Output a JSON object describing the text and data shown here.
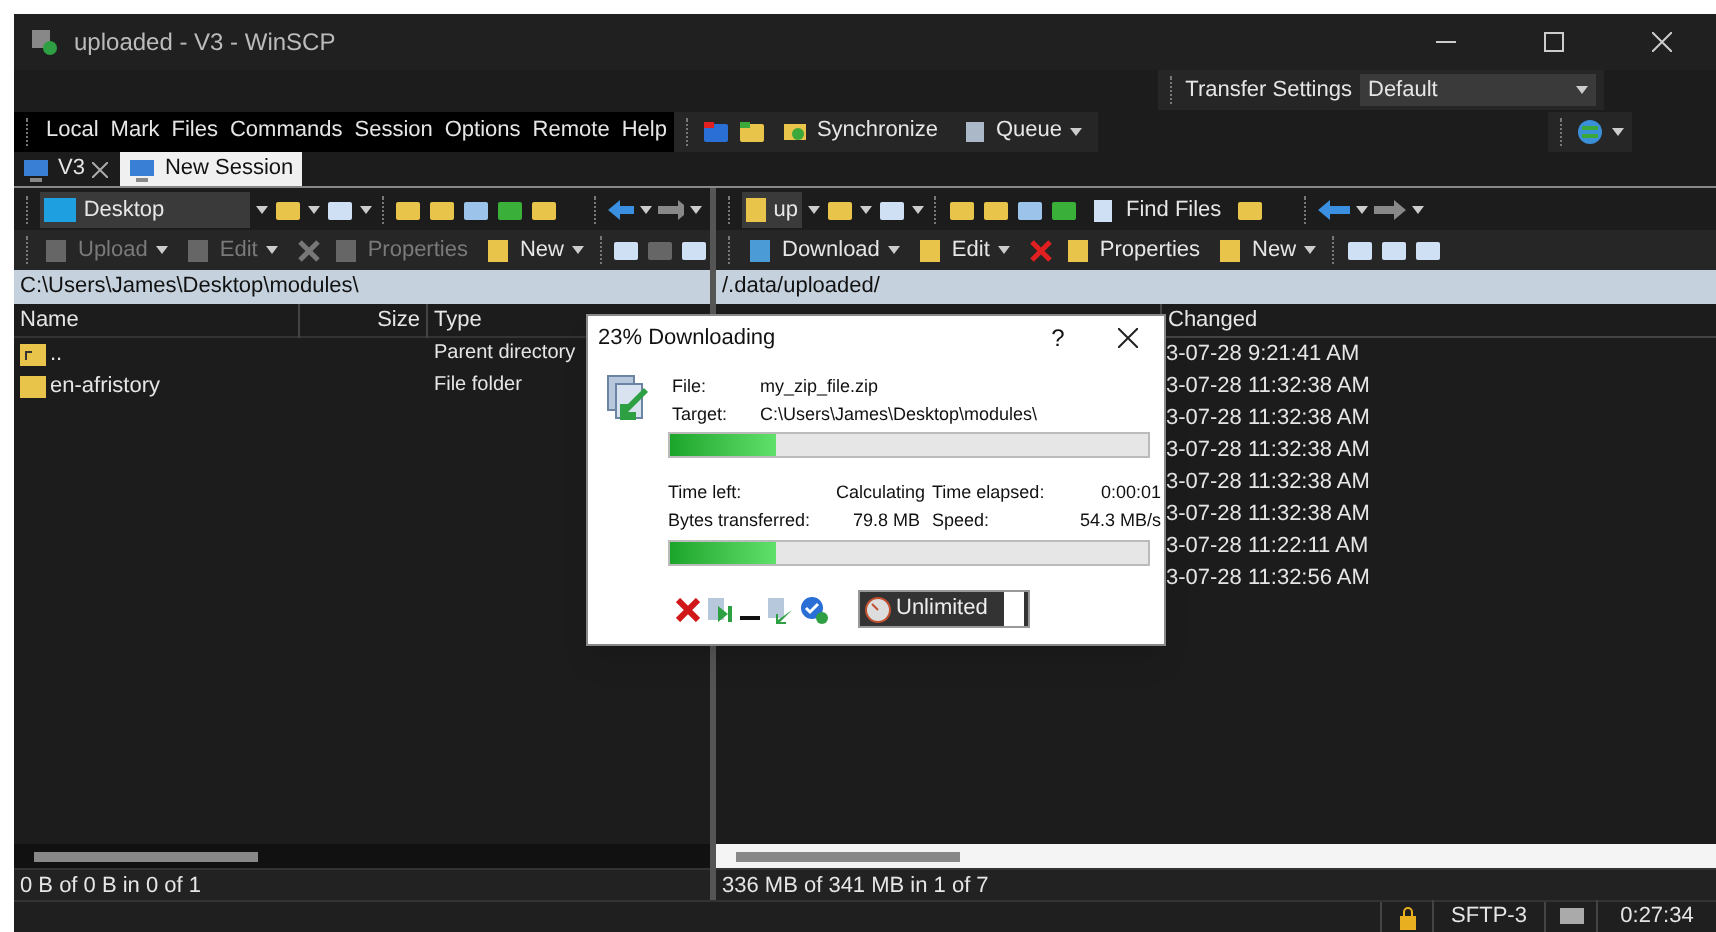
{
  "window": {
    "title": "uploaded - V3 - WinSCP"
  },
  "transfer_settings": {
    "label": "Transfer Settings",
    "value": "Default"
  },
  "menu": [
    "Local",
    "Mark",
    "Files",
    "Commands",
    "Session",
    "Options",
    "Remote",
    "Help"
  ],
  "toolbar": [
    {
      "kind": "button",
      "label": "Synchronize"
    },
    {
      "kind": "dropdown",
      "label": "Queue"
    }
  ],
  "tabs": [
    {
      "label": "V3",
      "selected": true,
      "closable": true
    },
    {
      "label": "New Session",
      "selected": false,
      "closable": false
    }
  ],
  "left_panel": {
    "location": "Desktop",
    "commands": [
      {
        "label": "Upload",
        "disabled": true,
        "dropdown": true
      },
      {
        "label": "Edit",
        "disabled": true,
        "dropdown": true
      },
      {
        "label": "Properties",
        "disabled": true,
        "dropdown": false
      },
      {
        "label": "New",
        "disabled": false,
        "dropdown": true
      }
    ],
    "path": "C:\\Users\\James\\Desktop\\modules\\",
    "columns": [
      "Name",
      "Size",
      "Type"
    ],
    "rows": [
      {
        "kind": "parent",
        "name": "..",
        "type": "Parent directory"
      },
      {
        "kind": "folder",
        "name": "en-afristory",
        "type": "File folder"
      }
    ],
    "status": "0 B of 0 B in 0 of 1"
  },
  "right_panel": {
    "location": "up",
    "find": "Find Files",
    "commands": [
      {
        "label": "Download",
        "disabled": false,
        "dropdown": true
      },
      {
        "label": "Edit",
        "disabled": false,
        "dropdown": true
      },
      {
        "label": "Properties",
        "disabled": false,
        "dropdown": false
      },
      {
        "label": "New",
        "disabled": false,
        "dropdown": true
      }
    ],
    "path": "/.data/uploaded/",
    "columns": [
      "Changed"
    ],
    "rows": [
      "3-07-28 9:21:41 AM",
      "3-07-28 11:32:38 AM",
      "3-07-28 11:32:38 AM",
      "3-07-28 11:32:38 AM",
      "3-07-28 11:32:38 AM",
      "3-07-28 11:32:38 AM",
      "3-07-28 11:22:11 AM",
      "3-07-28 11:32:56 AM"
    ],
    "status": "336 MB of 341 MB in 1 of 7"
  },
  "status_bar": {
    "protocol": "SFTP-3",
    "elapsed": "0:27:34"
  },
  "dialog": {
    "title": "23% Downloading",
    "help": "?",
    "file_label": "File:",
    "file": "my_zip_file.zip",
    "target_label": "Target:",
    "target": "C:\\Users\\James\\Desktop\\modules\\",
    "file_progress": {
      "level": 0.22
    },
    "stats": [
      {
        "label": "Time left:",
        "value": "Calculating"
      },
      {
        "label": "Time elapsed:",
        "value": "0:00:01"
      },
      {
        "label": "Bytes transferred:",
        "value": "79.8 MB"
      },
      {
        "label": "Speed:",
        "value": "54.3 MB/s"
      }
    ],
    "total_progress": {
      "level": 0.22
    },
    "speed_limit": "Unlimited"
  }
}
